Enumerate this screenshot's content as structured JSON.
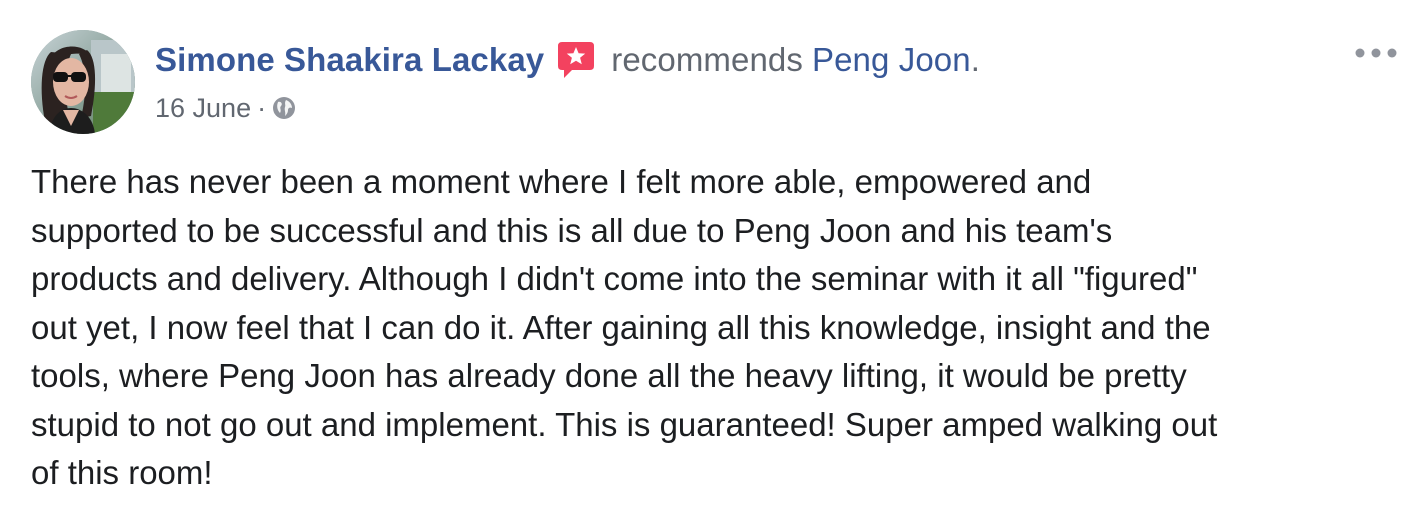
{
  "post": {
    "author_name": "Simone Shaakira Lackay",
    "recommendation_icon": "recommendation-star-badge-icon",
    "action_text": "recommends",
    "page_name": "Peng Joon",
    "period": ".",
    "date": "16 June",
    "separator": "·",
    "privacy_icon": "globe-icon",
    "more_icon": "more-options-icon",
    "body_lines": [
      "There has never been a moment where I felt more able, empowered and",
      "supported to be successful and this is all due to Peng Joon and his team's",
      "products and delivery. Although I didn't come into the seminar with it all \"figured\"",
      "out yet, I now feel that I can do it. After gaining all this knowledge, insight and the",
      "tools, where Peng Joon has already done all the heavy lifting, it would be pretty",
      "stupid to not go out and implement. This is guaranteed! Super amped walking out",
      "of this room!"
    ]
  },
  "colors": {
    "link_blue": "#385898",
    "meta_gray": "#616770",
    "body_text": "#1c1e21",
    "badge_red": "#f3425f"
  }
}
